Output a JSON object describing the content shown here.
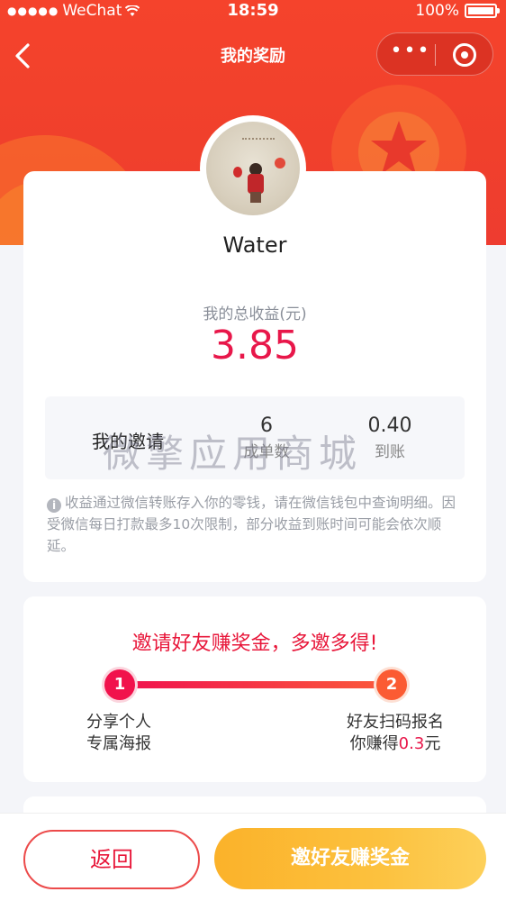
{
  "status_bar": {
    "carrier": "WeChat",
    "time": "18:59",
    "battery": "100%"
  },
  "nav": {
    "title": "我的奖励",
    "more_symbol": "•••"
  },
  "profile": {
    "username": "Water",
    "earnings_label": "我的总收益(元)",
    "earnings_value": "3.85"
  },
  "invites": {
    "title": "我的邀请",
    "orders_value": "6",
    "orders_label": "成单数",
    "arrived_value": "0.40",
    "arrived_label": "到账"
  },
  "watermark": "微擎应用商城",
  "notice": "收益通过微信转账存入你的零钱，请在微信钱包中查询明细。因受微信每日打款最多10次限制，部分收益到账时间可能会依次顺延。",
  "steps": {
    "title": "邀请好友赚奖金，多邀多得!",
    "step1_number": "1",
    "step1_line1": "分享个人",
    "step1_line2": "专属海报",
    "step2_number": "2",
    "step2_line1": "好友扫码报名",
    "step2_line2_prefix": "你赚得",
    "step2_amount": "0.3",
    "step2_line2_suffix": "元"
  },
  "bottom": {
    "back_label": "返回",
    "invite_label": "邀好友赚奖金"
  },
  "colors": {
    "header_red": "#f5432c",
    "accent_pink": "#e8174a",
    "button_gold": "#fbb22a"
  }
}
